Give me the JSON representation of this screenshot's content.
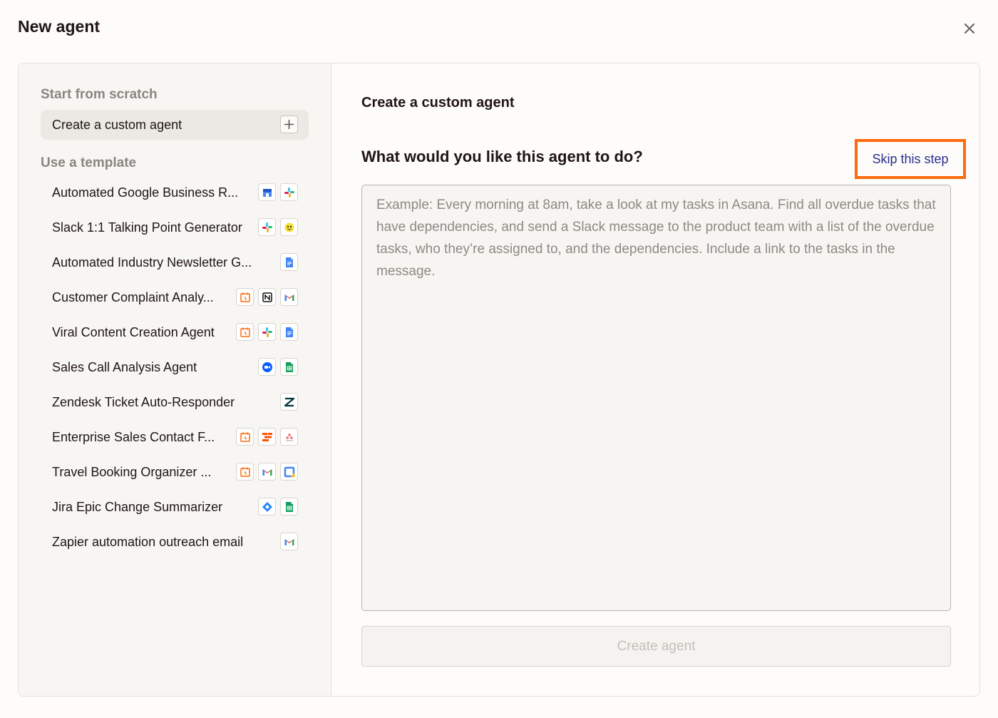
{
  "modal": {
    "title": "New agent"
  },
  "sidebar": {
    "scratch_label": "Start from scratch",
    "custom_item_label": "Create a custom agent",
    "template_label": "Use a template",
    "templates": [
      {
        "label": "Automated Google Business R...",
        "icons": [
          "google-business-icon",
          "slack-icon"
        ]
      },
      {
        "label": "Slack 1:1 Talking Point Generator",
        "icons": [
          "slack-icon",
          "chatbot-icon"
        ]
      },
      {
        "label": "Automated Industry Newsletter G...",
        "icons": [
          "google-docs-icon"
        ]
      },
      {
        "label": "Customer Complaint Analy...",
        "icons": [
          "schedule-icon",
          "notion-icon",
          "gmail-icon"
        ]
      },
      {
        "label": "Viral Content Creation Agent",
        "icons": [
          "schedule-icon",
          "slack-icon",
          "google-docs-icon"
        ]
      },
      {
        "label": "Sales Call Analysis Agent",
        "icons": [
          "zoom-icon",
          "google-sheets-icon"
        ]
      },
      {
        "label": "Zendesk Ticket Auto-Responder",
        "icons": [
          "zendesk-icon"
        ]
      },
      {
        "label": "Enterprise Sales Contact F...",
        "icons": [
          "schedule-icon",
          "formatter-icon",
          "asana-icon"
        ]
      },
      {
        "label": "Travel Booking Organizer ...",
        "icons": [
          "schedule-icon",
          "gmail-icon",
          "google-calendar-icon"
        ]
      },
      {
        "label": "Jira Epic Change Summarizer",
        "icons": [
          "jira-icon",
          "google-sheets-icon"
        ]
      },
      {
        "label": "Zapier automation outreach email",
        "icons": [
          "gmail-icon"
        ]
      }
    ]
  },
  "main": {
    "heading": "Create a custom agent",
    "question": "What would you like this agent to do?",
    "skip_label": "Skip this step",
    "prompt_placeholder": "Example: Every morning at 8am, take a look at my tasks in Asana. Find all overdue tasks that have dependencies, and send a Slack message to the product team with a list of the overdue tasks, who they’re assigned to, and the dependencies. Include a link to the tasks in the message.",
    "prompt_value": "",
    "create_label": "Create agent"
  },
  "colors": {
    "highlight": "#ff6a0c",
    "link": "#2b2f8f",
    "sidebar_bg": "#f7f6f3"
  }
}
